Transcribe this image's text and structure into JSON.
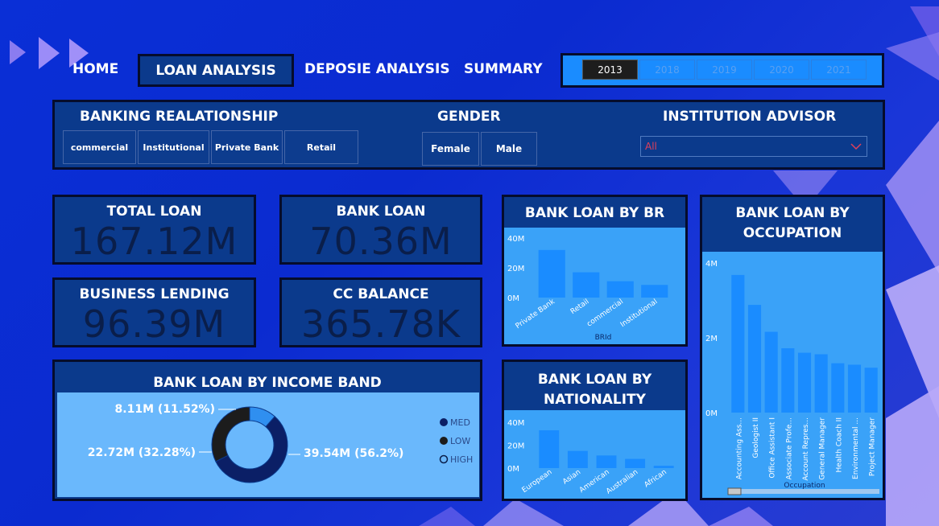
{
  "nav": {
    "home": "HOME",
    "loan_analysis": "LOAN ANALYSIS",
    "deposit_analysis": "DEPOSIE ANALYSIS",
    "summary": "SUMMARY"
  },
  "years": [
    "2013",
    "2018",
    "2019",
    "2020",
    "2021"
  ],
  "selected_year": "2013",
  "filters": {
    "banking_title": "BANKING REALATIONSHIP",
    "banking_options": [
      "commercial",
      "Institutional",
      "Private Bank",
      "Retail"
    ],
    "gender_title": "GENDER",
    "gender_options": [
      "Female",
      "Male"
    ],
    "advisor_title": "INSTITUTION ADVISOR",
    "advisor_value": "All"
  },
  "kpis": {
    "total_loan": {
      "label": "TOTAL LOAN",
      "value": "167.12M"
    },
    "bank_loan": {
      "label": "BANK LOAN",
      "value": "70.36M"
    },
    "business_lending": {
      "label": "BUSINESS LENDING",
      "value": "96.39M"
    },
    "cc_balance": {
      "label": "CC BALANCE",
      "value": "365.78K"
    }
  },
  "colors": {
    "bar": "#1a8cff",
    "plot_bg": "#3aa2f8",
    "med": "#0b1f66",
    "low": "#1c1c1c",
    "high": "#2f8ff0"
  },
  "chart_data": [
    {
      "type": "bar",
      "title": "BANK LOAN BY BR",
      "xlabel": "BRId",
      "ylabel": "",
      "categories": [
        "Private Bank",
        "Retail",
        "commercial",
        "Institutional"
      ],
      "values": [
        32,
        17,
        11,
        8.5
      ],
      "ylim": [
        0,
        40
      ],
      "yticks": [
        "0M",
        "20M",
        "40M"
      ],
      "grid": false
    },
    {
      "type": "bar",
      "title": "BANK LOAN BY OCCUPATION",
      "xlabel": "Occupation",
      "ylabel": "",
      "categories": [
        "Accounting Ass...",
        "Geologist II",
        "Office Assistant I",
        "Associate Profe...",
        "Account Repres...",
        "General Manager",
        "Health Coach II",
        "Environmental ...",
        "Project Manager"
      ],
      "values": [
        4.6,
        3.6,
        2.7,
        2.15,
        2.0,
        1.95,
        1.65,
        1.6,
        1.5
      ],
      "ylim": [
        0,
        5
      ],
      "yticks": [
        "0M",
        "2M",
        "4M"
      ],
      "grid": false
    },
    {
      "type": "bar",
      "title": "BANK LOAN BY NATIONALITY",
      "xlabel": "",
      "ylabel": "",
      "categories": [
        "European",
        "Asian",
        "American",
        "Australian",
        "African"
      ],
      "values": [
        33,
        15,
        11,
        8,
        2
      ],
      "ylim": [
        0,
        40
      ],
      "yticks": [
        "0M",
        "20M",
        "40M"
      ],
      "grid": false
    },
    {
      "type": "pie",
      "title": "BANK LOAN BY INCOME BAND",
      "categories": [
        "MED",
        "LOW",
        "HIGH"
      ],
      "values": [
        39.54,
        22.72,
        8.11
      ],
      "labels": [
        "39.54M (56.2%)",
        "22.72M (32.28%)",
        "8.11M (11.52%)"
      ],
      "legend": "right"
    }
  ]
}
